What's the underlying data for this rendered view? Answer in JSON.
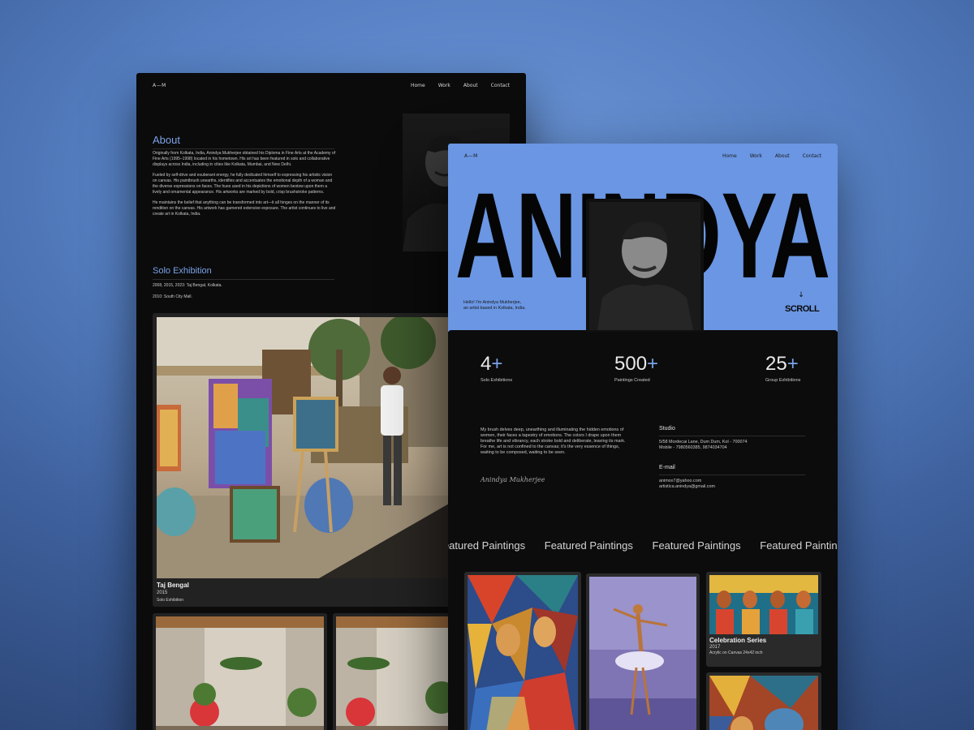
{
  "left_page": {
    "nav": {
      "brand": "A—M",
      "links": [
        "Home",
        "Work",
        "About",
        "Contact"
      ]
    },
    "about": {
      "title": "About",
      "paragraphs": [
        "Originally from Kolkata, India, Anindya Mukherjee obtained his Diploma in Fine Arts at the Academy of Fine Arts (1995–1998) located in his hometown. His art has been featured in solo and collaborative displays across India, including in cities like Kolkata, Mumbai, and New Delhi.",
        "Fueled by self-drive and exuberant energy, he fully dedicated himself to expressing his artistic vision on canvas. His paintbrush unearths, identifies and accentuates the emotional depth of a woman and the diverse expressions on faces. The hues used in his depictions of women bestow upon them a lively and ornamental appearance. His artworks are marked by bold, crisp brushstroke patterns.",
        "He maintains the belief that anything can be transformed into art—it all hinges on the manner of its rendition on the canvas. His artwork has garnered extensive exposure. The artist continues to live and create art in Kolkata, India."
      ]
    },
    "solo": {
      "title": "Solo Exhibition",
      "lines": [
        "2008, 2015, 2023: Taj Bengal, Kolkata.",
        "2010: South City Mall."
      ]
    },
    "exhibition_card": {
      "name": "Taj Bengal",
      "year": "2015",
      "type": "Solo Exhibition"
    }
  },
  "right_page": {
    "nav": {
      "brand": "A—M",
      "links": [
        "Home",
        "Work",
        "About",
        "Contact"
      ]
    },
    "hero": {
      "big_name": "ANINDYA",
      "intro_line1": "Hello! I'm Anindya Mukherjee,",
      "intro_line2": "an artist based in Kolkata, India.",
      "scroll_label": "SCROLL",
      "scroll_arrow": "↓"
    },
    "stats": [
      {
        "value": "4",
        "suffix": "+",
        "caption": "Solo Exhibitions"
      },
      {
        "value": "500",
        "suffix": "+",
        "caption": "Paintings Created"
      },
      {
        "value": "25",
        "suffix": "+",
        "caption": "Group Exhibitions"
      }
    ],
    "bio": "My brush delves deep, unearthing and illuminating the hidden emotions of women, their faces a tapestry of emotions. The colors I drape upon them breathe life and vibrancy, each stroke bold and deliberate, leaving its mark. For me, art is not confined to the canvas; it's the very essence of things, waiting to be composed, waiting to be seen.",
    "signature": "Anindya Mukherjee",
    "contact": {
      "studio_title": "Studio",
      "studio_line1": "5/58 Mordecai Lane, Dum Dum, Kol - 700074",
      "studio_line2": "Mobile - 7980560385, 9874034704",
      "email_title": "E-mail",
      "email_line1": "animox7@yahoo.com",
      "email_line2": "artistica.anindya@gmail.com"
    },
    "marquee": [
      "Featured Paintings",
      "Featured Paintings",
      "Featured Paintings",
      "Featured Paintings"
    ],
    "featured": [
      {
        "title": "Celebration Series",
        "year": "2017",
        "medium": "Acrylic on Canvas 24x42 inch"
      }
    ]
  },
  "colors": {
    "background": "#5b85c8",
    "accent_blue": "#7ba3e8",
    "hero_blue": "#6a96e3",
    "panel_dark": "#0b0b0c"
  }
}
